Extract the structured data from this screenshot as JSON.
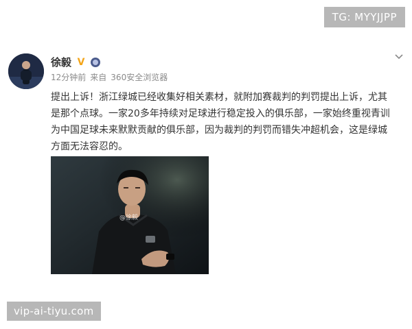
{
  "overlays": {
    "top_watermark": "TG: MYYJJPP",
    "bottom_watermark": "vip-ai-tiyu.com"
  },
  "post": {
    "author": "徐毅",
    "time": "12分钟前",
    "source_prefix": "来自",
    "source": "360安全浏览器",
    "text": "提出上诉！浙江绿城已经收集好相关素材，就附加赛裁判的判罚提出上诉，尤其是那个点球。一家20多年持续对足球进行稳定投入的俱乐部，一家始终重视青训为中国足球未来默默贡献的俱乐部，因为裁判的判罚而错失冲超机会，这是绿城方面无法容忍的。",
    "image_watermark": "@徐毅",
    "icons": {
      "verified": "verified-v-icon",
      "level": "level-badge-icon",
      "menu": "chevron-down-icon"
    }
  },
  "colors": {
    "verified": "#f3a51a",
    "meta": "#8a8a8a",
    "text": "#333333"
  }
}
